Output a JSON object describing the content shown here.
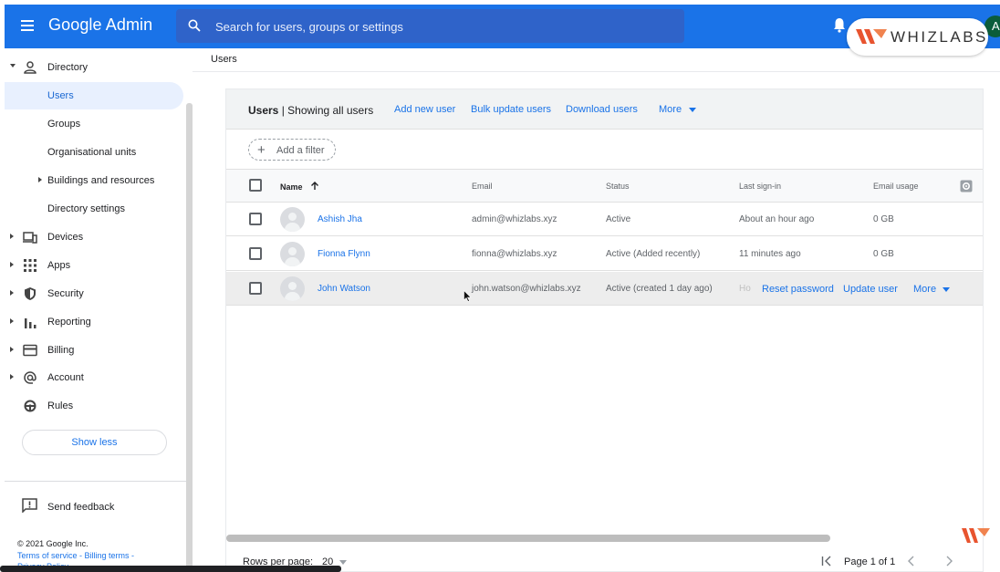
{
  "header": {
    "app_title": "Google Admin",
    "search_placeholder": "Search for users, groups or settings",
    "avatar_letter": "A",
    "brand_badge": "WHIZLABS",
    "colors": {
      "topbar": "#1a73e8",
      "accent": "#1a73e8",
      "active_nav_bg": "#e8f0fe"
    }
  },
  "sidebar": {
    "items": [
      {
        "label": "Directory",
        "icon": "person-icon",
        "expanded": true
      },
      {
        "label": "Users",
        "active": true
      },
      {
        "label": "Groups"
      },
      {
        "label": "Organisational units"
      },
      {
        "label": "Buildings and resources",
        "collapsed_caret": true
      },
      {
        "label": "Directory settings"
      },
      {
        "label": "Devices",
        "icon": "devices-icon"
      },
      {
        "label": "Apps",
        "icon": "apps-grid-icon"
      },
      {
        "label": "Security",
        "icon": "shield-icon"
      },
      {
        "label": "Reporting",
        "icon": "bar-chart-icon"
      },
      {
        "label": "Billing",
        "icon": "credit-card-icon"
      },
      {
        "label": "Account",
        "icon": "at-sign-icon"
      },
      {
        "label": "Rules",
        "icon": "steering-icon"
      }
    ],
    "show_less": "Show less",
    "send_feedback": "Send feedback",
    "copyright": "© 2021 Google Inc.",
    "legal": "Terms of service - Billing terms -",
    "privacy": "Privacy Policy"
  },
  "breadcrumb": "Users",
  "users_panel": {
    "title_bold": "Users",
    "title_rest": " | Showing all users",
    "actions": [
      "Add new user",
      "Bulk update users",
      "Download users",
      "More"
    ],
    "add_filter": "Add a filter",
    "columns": [
      "Name",
      "Email",
      "Status",
      "Last sign-in",
      "Email usage"
    ],
    "rows": [
      {
        "name": "Ashish Jha",
        "email": "admin@whizlabs.xyz",
        "status": "Active",
        "last_signin": "About an hour ago",
        "usage": "0 GB"
      },
      {
        "name": "Fionna Flynn",
        "email": "fionna@whizlabs.xyz",
        "status": "Active (Added recently)",
        "last_signin": "11 minutes ago",
        "usage": "0 GB"
      },
      {
        "name": "John Watson",
        "email": "john.watson@whizlabs.xyz",
        "status": "Active (created 1 day ago)",
        "last_signin": "Ho",
        "usage": ""
      }
    ],
    "row_actions": [
      "Reset password",
      "Update user",
      "More"
    ],
    "footer": {
      "rows_per_page_label": "Rows per page:",
      "rows_per_page_value": "20",
      "page_indicator": "Page 1 of 1"
    }
  }
}
